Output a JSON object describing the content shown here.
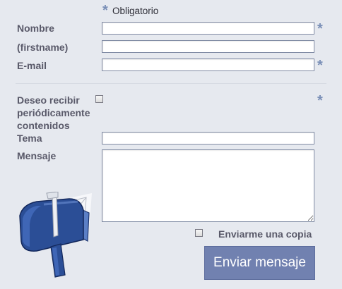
{
  "form": {
    "required_note": {
      "star": "*",
      "text": "Obligatorio"
    },
    "fields": {
      "nombre": {
        "label": "Nombre",
        "value": "",
        "required_star": "*"
      },
      "firstname": {
        "label": "(firstname)",
        "value": ""
      },
      "email": {
        "label": "E-mail",
        "value": "",
        "required_star": "*"
      },
      "deseo": {
        "label_lines": [
          "Deseo recibir",
          "periódicamente",
          "contenidos"
        ],
        "required_star": "*"
      },
      "tema": {
        "label": "Tema",
        "value": ""
      },
      "mensaje": {
        "label": "Mensaje",
        "value": ""
      }
    },
    "copy_checkbox_label": "Enviarme una copia",
    "submit_label": "Enviar mensaje"
  },
  "icons": {
    "mailbox": "mailbox-icon",
    "required": "asterisk-icon"
  },
  "colors": {
    "background": "#e6e9ef",
    "accent_star": "#7a8fb7",
    "submit_bg": "#7181b0",
    "mailbox_blue": "#2b4e96"
  }
}
